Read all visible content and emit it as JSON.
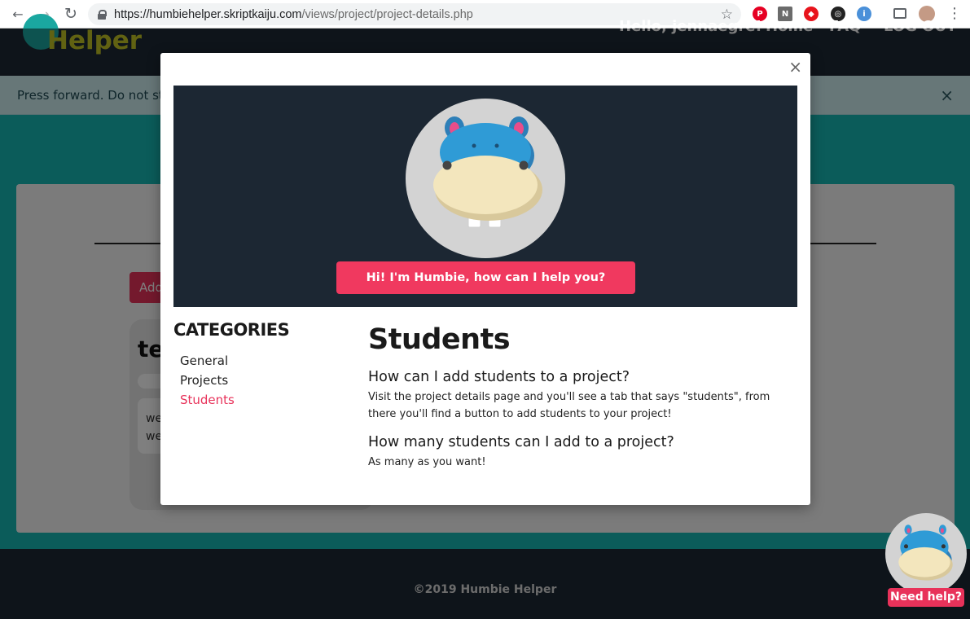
{
  "browser": {
    "url_host": "https://humbiehelper.skriptkaiju.com",
    "url_path": "/views/project/project-details.php",
    "back_glyph": "←",
    "forward_glyph": "→",
    "reload_glyph": "↻",
    "star_glyph": "☆",
    "menu_glyph": "⋮",
    "extensions": [
      {
        "name": "pinterest-icon",
        "color": "#e60023",
        "glyph": "P"
      },
      {
        "name": "notion-icon",
        "color": "#6b6b6b",
        "glyph": "N"
      },
      {
        "name": "shield-extension-icon",
        "color": "#e8141c",
        "glyph": "◆"
      },
      {
        "name": "camera-extension-icon",
        "color": "#222222",
        "glyph": "◎"
      },
      {
        "name": "onenote-extension-icon",
        "color": "#4a90d9",
        "glyph": "i"
      }
    ]
  },
  "site": {
    "logo_text": "Helper",
    "nav": {
      "greeting": "Hello, jennaegre!",
      "home": "Home",
      "faq": "FAQ",
      "logout": "LOG OUT"
    },
    "alert_text": "Press forward. Do not stop",
    "alert_close": "×",
    "add_button": "Add",
    "project_title": "te",
    "project_body_line1": "we",
    "project_body_line2": "we",
    "footer": "©2019 Humbie Helper"
  },
  "helper_widget": {
    "button_label": "Need help?"
  },
  "modal": {
    "close": "×",
    "greeting_button": "Hi! I'm Humbie, how can I help you?",
    "categories_heading": "CATEGORIES",
    "categories": [
      {
        "label": "General",
        "active": false
      },
      {
        "label": "Projects",
        "active": false
      },
      {
        "label": "Students",
        "active": true
      }
    ],
    "section_title": "Students",
    "faqs": [
      {
        "question": "How can I add students to a project?",
        "answer": "Visit the project details page and you'll see a tab that says \"students\", from there you'll find a button to add students to your project!"
      },
      {
        "question": "How many students can I add to a project?",
        "answer": "As many as you want!"
      }
    ]
  },
  "colors": {
    "accent_pink": "#e8325a",
    "header_dark": "#1d2935",
    "teal": "#17b9b4",
    "logo_yellow": "#c2c424",
    "hippo_blue": "#2f9bd6",
    "hippo_cream": "#f3e6bd"
  }
}
